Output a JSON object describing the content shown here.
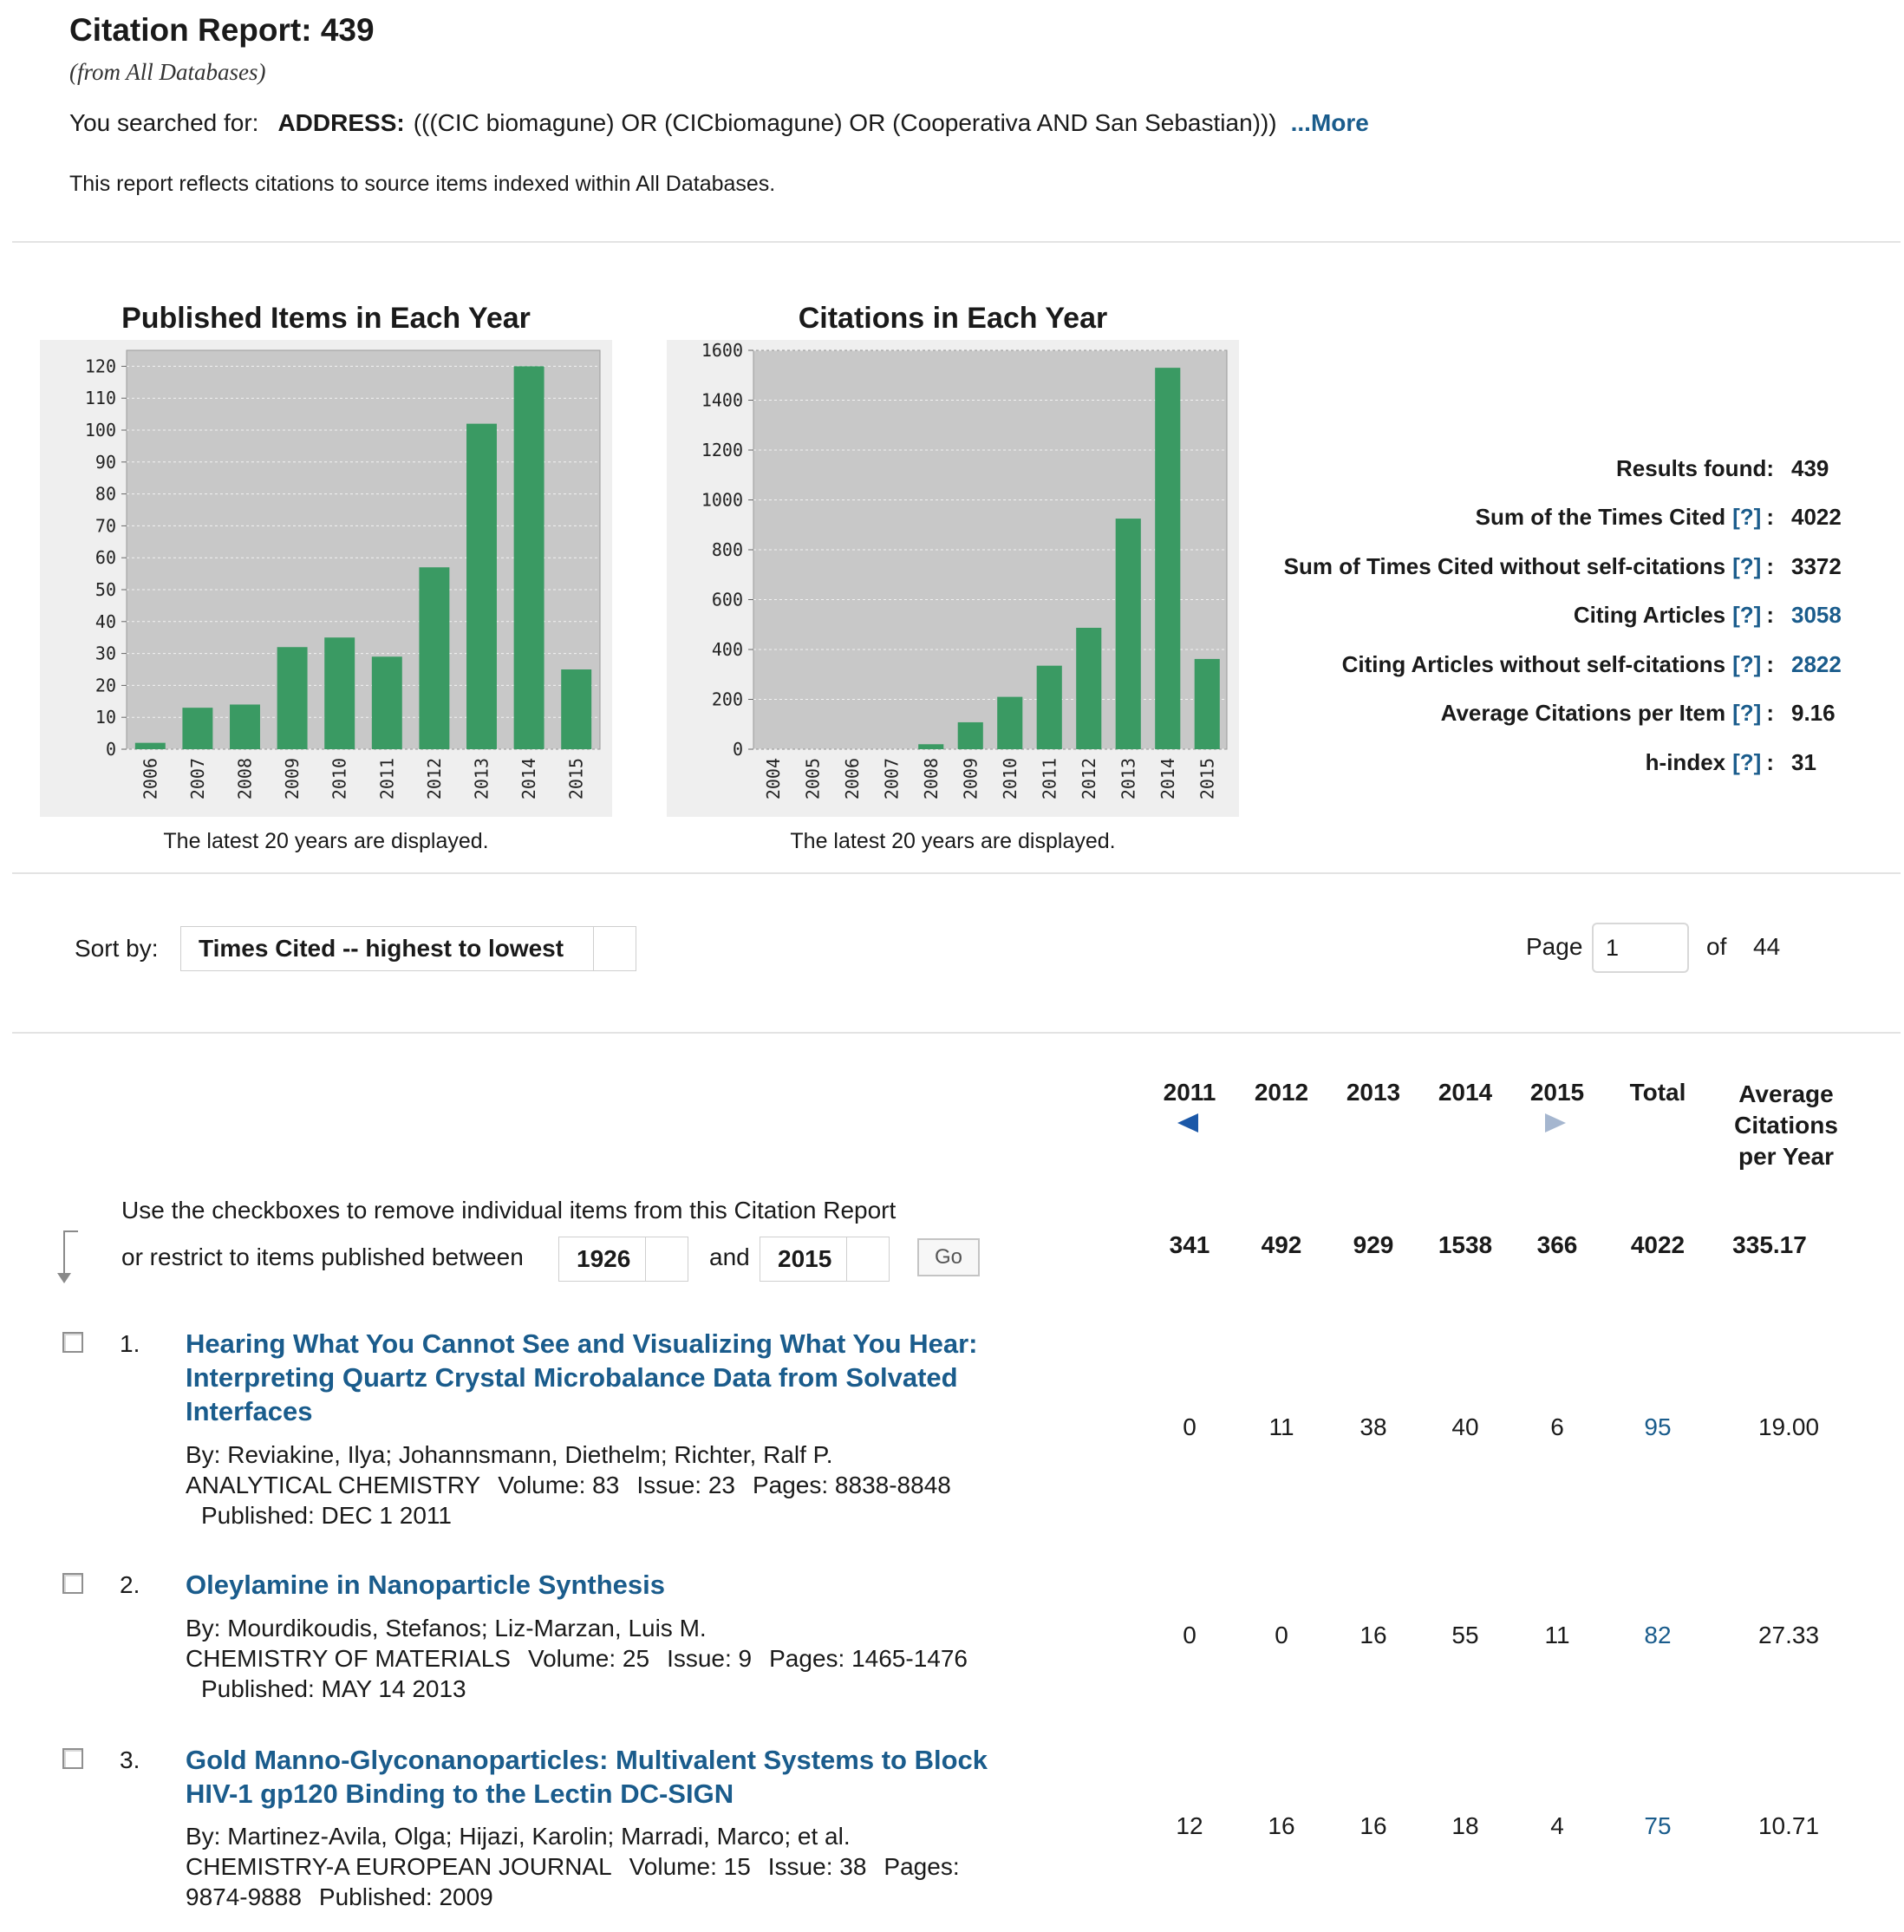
{
  "header": {
    "title_label": "Citation Report: ",
    "title_count": "439",
    "subtitle": "(from All Databases)",
    "searched_label": "You searched for:",
    "search_field": "ADDRESS:",
    "search_query": "(((CIC biomagune) OR (CICbiomagune) OR (Cooperativa AND San Sebastian)))",
    "more_link": "...More",
    "reflects": "This report reflects citations to source items indexed within All Databases."
  },
  "chart_data": [
    {
      "type": "bar",
      "title": "Published Items in Each Year",
      "categories": [
        "2006",
        "2007",
        "2008",
        "2009",
        "2010",
        "2011",
        "2012",
        "2013",
        "2014",
        "2015"
      ],
      "values": [
        2,
        13,
        14,
        32,
        35,
        29,
        57,
        102,
        120,
        25
      ],
      "ylim": [
        0,
        125
      ],
      "yticks": [
        0,
        10,
        20,
        30,
        40,
        50,
        60,
        70,
        80,
        90,
        100,
        110,
        120
      ],
      "grid": true,
      "color": "#3a9a63",
      "note": "The latest 20 years are displayed."
    },
    {
      "type": "bar",
      "title": "Citations in Each Year",
      "categories": [
        "2004",
        "2005",
        "2006",
        "2007",
        "2008",
        "2009",
        "2010",
        "2011",
        "2012",
        "2013",
        "2014",
        "2015"
      ],
      "values": [
        0,
        0,
        0,
        0,
        20,
        108,
        210,
        335,
        487,
        925,
        1530,
        362
      ],
      "ylim": [
        0,
        1600
      ],
      "yticks": [
        0,
        200,
        400,
        600,
        800,
        1000,
        1200,
        1400,
        1600
      ],
      "grid": true,
      "color": "#3a9a63",
      "note": "The latest 20 years are displayed."
    }
  ],
  "stats": [
    {
      "label": "Results found:",
      "help": "",
      "value": "439",
      "link": false
    },
    {
      "label": "Sum of the Times Cited",
      "help": "[?]",
      "value": "4022",
      "link": false
    },
    {
      "label": "Sum of Times Cited without self-citations",
      "help": "[?]",
      "value": "3372",
      "link": false
    },
    {
      "label": "Citing Articles",
      "help": "[?]",
      "value": "3058",
      "link": true
    },
    {
      "label": "Citing Articles without self-citations",
      "help": "[?]",
      "value": "2822",
      "link": true
    },
    {
      "label": "Average Citations per Item",
      "help": "[?]",
      "value": "9.16",
      "link": false
    },
    {
      "label": "h-index",
      "help": "[?]",
      "value": "31",
      "link": false
    }
  ],
  "controls": {
    "sort_label": "Sort by:",
    "sort_value": "Times Cited -- highest to lowest",
    "page_label": "Page",
    "page_value": "1",
    "of_label": "of",
    "page_total": "44"
  },
  "table": {
    "years": [
      "2011",
      "2012",
      "2013",
      "2014",
      "2015"
    ],
    "total_label": "Total",
    "avg_label": "Average Citations per Year",
    "instruction1": "Use the checkboxes to remove individual items from this Citation Report",
    "instruction2": "or restrict to items published between",
    "from_year": "1926",
    "and_label": "and",
    "to_year": "2015",
    "go_label": "Go",
    "totals": [
      "341",
      "492",
      "929",
      "1538",
      "366",
      "4022",
      "335.17"
    ],
    "records": [
      {
        "index": "1.",
        "title": "Hearing What You Cannot See and Visualizing What You Hear: Interpreting Quartz Crystal Microbalance Data from Solvated Interfaces",
        "authors": "By: Reviakine, Ilya; Johannsmann, Diethelm; Richter, Ralf P.",
        "journal": "ANALYTICAL CHEMISTRY",
        "volume": "Volume: 83",
        "issue": "Issue: 23",
        "pages": "Pages: 8838-8848",
        "published": "Published: DEC 1 2011",
        "counts": [
          "0",
          "11",
          "38",
          "40",
          "6"
        ],
        "total": "95",
        "avg": "19.00"
      },
      {
        "index": "2.",
        "title": "Oleylamine in Nanoparticle Synthesis",
        "authors": "By: Mourdikoudis, Stefanos; Liz-Marzan, Luis M.",
        "journal": "CHEMISTRY OF MATERIALS",
        "volume": "Volume: 25",
        "issue": "Issue: 9",
        "pages": "Pages: 1465-1476",
        "published": "Published: MAY 14 2013",
        "counts": [
          "0",
          "0",
          "16",
          "55",
          "11"
        ],
        "total": "82",
        "avg": "27.33"
      },
      {
        "index": "3.",
        "title": "Gold Manno-Glyconanoparticles: Multivalent Systems to Block HIV-1 gp120 Binding to the Lectin DC-SIGN",
        "authors": "By: Martinez-Avila, Olga; Hijazi, Karolin; Marradi, Marco; et al.",
        "journal": "CHEMISTRY-A EUROPEAN JOURNAL",
        "volume": "Volume: 15",
        "issue": "Issue: 38",
        "pages_label": "Pages:",
        "pages_value": "9874-9888",
        "published": "Published: 2009",
        "counts": [
          "12",
          "16",
          "16",
          "18",
          "4"
        ],
        "total": "75",
        "avg": "10.71"
      }
    ]
  }
}
